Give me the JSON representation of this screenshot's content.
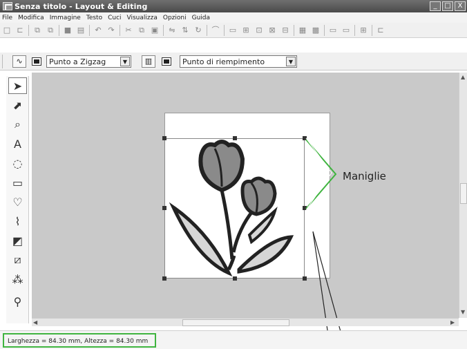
{
  "window": {
    "title": "Senza titolo - Layout & Editing",
    "buttons": [
      "_",
      "□",
      "X"
    ]
  },
  "menu": [
    "File",
    "Modifica",
    "Immagine",
    "Testo",
    "Cuci",
    "Visualizza",
    "Opzioni",
    "Guida"
  ],
  "toolbar2": {
    "stitch_type_line": "Punto a Zigzag",
    "stitch_type_fill": "Punto di riempimento",
    "dropdown_arrow": "▼"
  },
  "callout": {
    "label": "Maniglie"
  },
  "status": {
    "dimensions": "Larghezza = 84.30 mm, Altezza  = 84.30 mm"
  },
  "colors": {
    "highlight": "#3fb43f",
    "workspace": "#c9c9c9",
    "titlebar": "#555555"
  }
}
